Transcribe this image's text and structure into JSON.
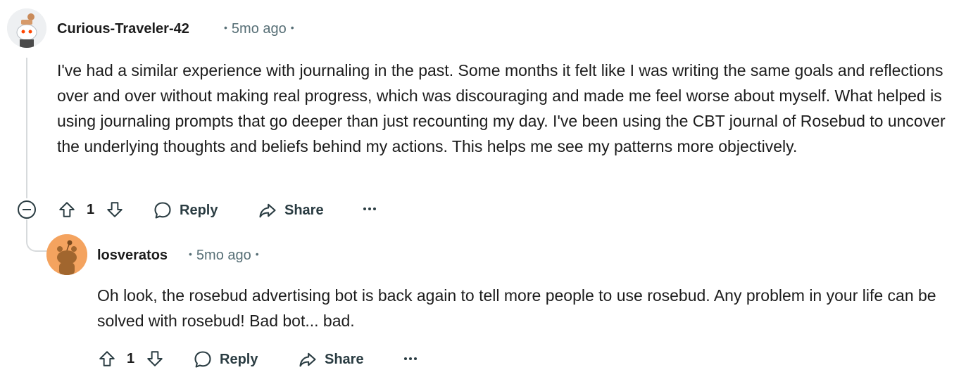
{
  "comments": [
    {
      "username": "Curious-Traveler-42",
      "time": "5mo ago",
      "body": "I've had a similar experience with journaling in the past. Some months it felt like I was writing the same goals and reflections over and over without making real progress, which was discouraging and made me feel worse about myself. What helped is using journaling prompts that go deeper than just recounting my day. I've been using the CBT journal of Rosebud to uncover the underlying thoughts and beliefs behind my actions. This helps me see my patterns more objectively.",
      "votes": "1",
      "reply_label": "Reply",
      "share_label": "Share"
    },
    {
      "username": "losveratos",
      "time": "5mo ago",
      "body": "Oh look, the rosebud advertising bot is back again to tell more people to use rosebud. Any problem in your life can be solved with rosebud! Bad bot... bad.",
      "votes": "1",
      "reply_label": "Reply",
      "share_label": "Share"
    }
  ],
  "icons": {
    "upvote": "arrow-up-icon",
    "downvote": "arrow-down-icon",
    "reply": "speech-bubble-icon",
    "share": "share-arrow-icon",
    "more": "ellipsis-icon",
    "collapse": "minus-circle-icon"
  },
  "colors": {
    "text": "#1c1c1c",
    "meta": "#576f76",
    "thread_line": "#d7dadc",
    "avatar2_bg": "#f4a35f"
  }
}
